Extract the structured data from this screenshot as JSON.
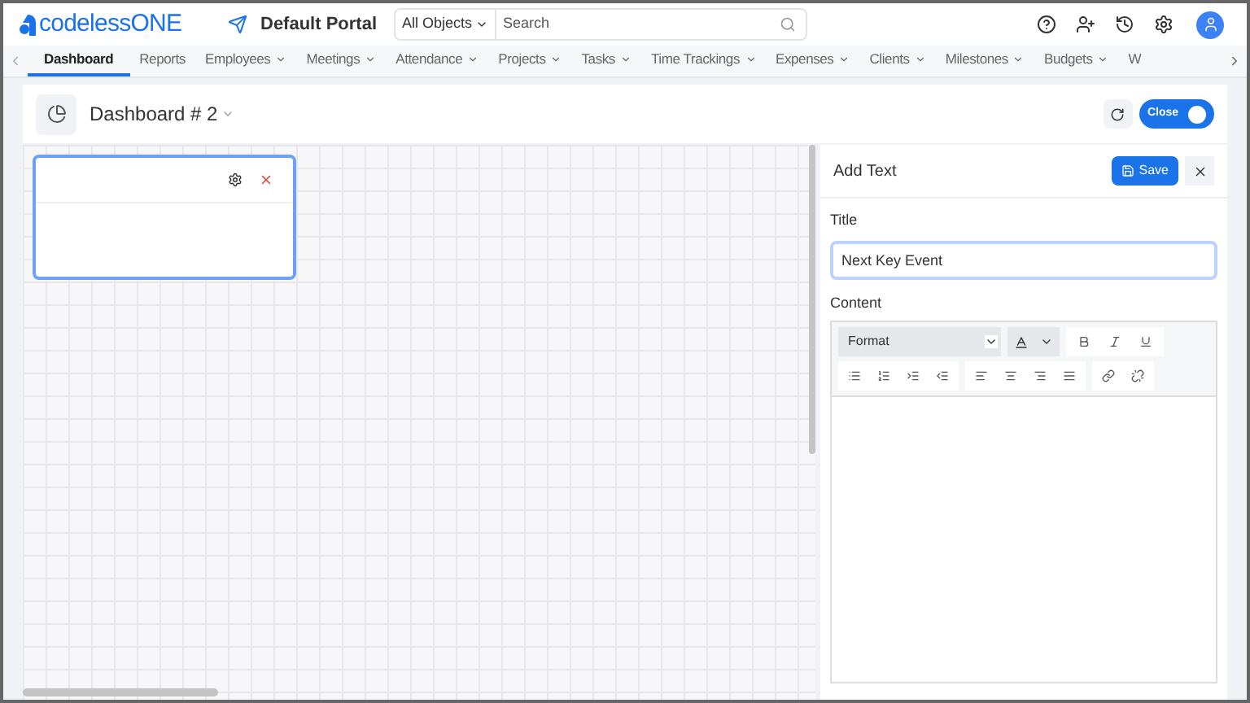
{
  "header": {
    "logo": "codelessONE",
    "portal": "Default Portal",
    "scope": "All Objects",
    "search": {
      "placeholder": "Search"
    }
  },
  "tabs": [
    {
      "label": "Dashboard",
      "selected": true,
      "menu": false
    },
    {
      "label": "Reports",
      "selected": false,
      "menu": false
    },
    {
      "label": "Employees",
      "selected": false,
      "menu": true
    },
    {
      "label": "Meetings",
      "selected": false,
      "menu": true
    },
    {
      "label": "Attendance",
      "selected": false,
      "menu": true
    },
    {
      "label": "Projects",
      "selected": false,
      "menu": true
    },
    {
      "label": "Tasks",
      "selected": false,
      "menu": true
    },
    {
      "label": "Time Trackings",
      "selected": false,
      "menu": true
    },
    {
      "label": "Expenses",
      "selected": false,
      "menu": true
    },
    {
      "label": "Clients",
      "selected": false,
      "menu": true
    },
    {
      "label": "Milestones",
      "selected": false,
      "menu": true
    },
    {
      "label": "Budgets",
      "selected": false,
      "menu": true
    },
    {
      "label": "W",
      "selected": false,
      "menu": false
    }
  ],
  "dashboard": {
    "title": "Dashboard # 2",
    "toggle": {
      "label": "Close",
      "on": true
    }
  },
  "panel": {
    "title": "Add Text",
    "save": "Save",
    "title_label": "Title",
    "title_value": "Next Key Event",
    "content_label": "Content",
    "format": "Format"
  }
}
